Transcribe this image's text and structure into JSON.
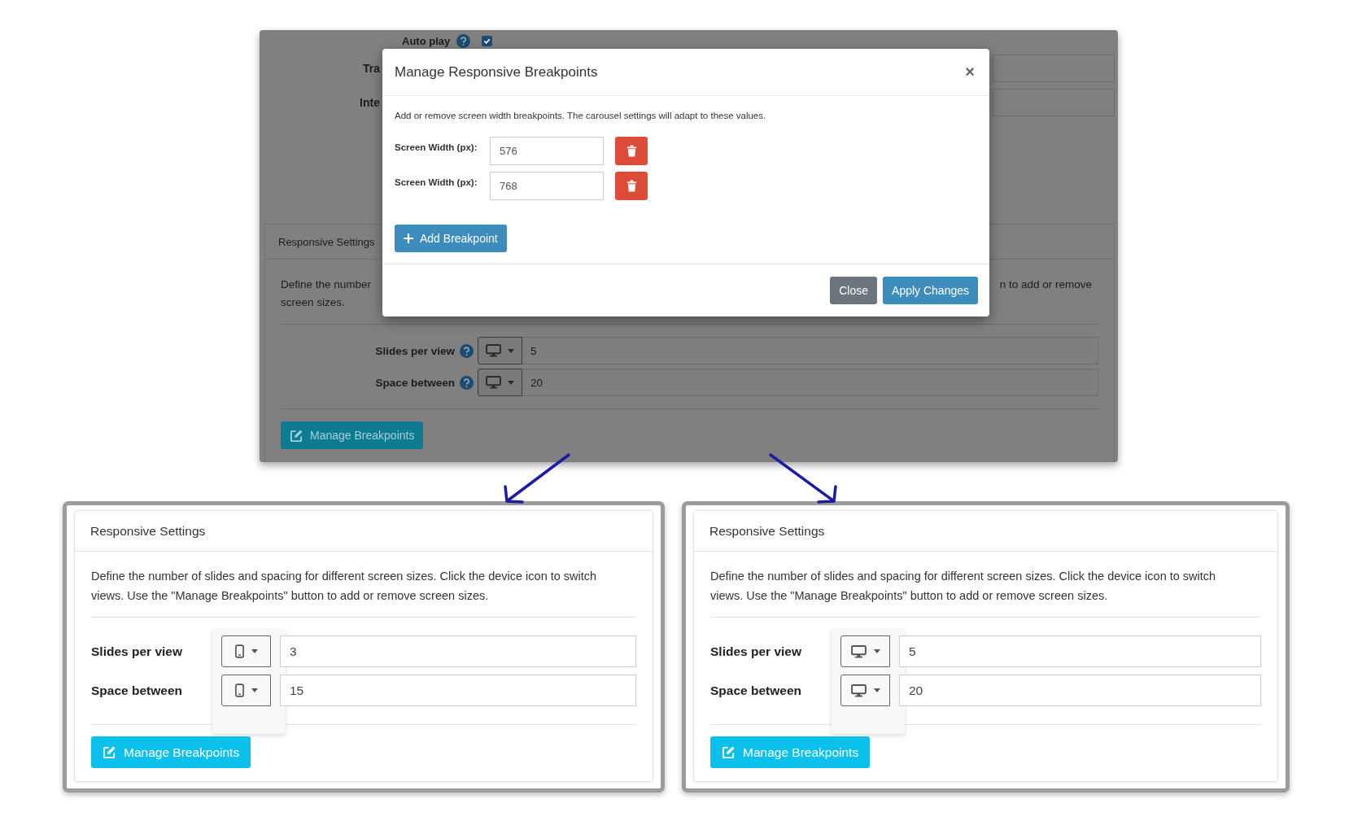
{
  "background_page": {
    "auto_play": {
      "label": "Auto play",
      "checked": true
    },
    "field_labels": [
      "Tra",
      "Inte"
    ],
    "responsive_settings": {
      "title": "Responsive Settings",
      "description_start": "Define the number",
      "description_end": "n to add or remove",
      "description_last": "screen sizes.",
      "rows": [
        {
          "label": "Slides per view",
          "kind": "desktop",
          "value": "5"
        },
        {
          "label": "Space between",
          "kind": "desktop",
          "value": "20"
        }
      ],
      "button": "Manage Breakpoints"
    }
  },
  "modal": {
    "title": "Manage Responsive Breakpoints",
    "close_icon": "×",
    "description": "Add or remove screen width breakpoints. The carousel settings will adapt to these values.",
    "breakpoints": [
      {
        "label": "Screen Width (px):",
        "value": "576"
      },
      {
        "label": "Screen Width (px):",
        "value": "768"
      }
    ],
    "add_button": "Add Breakpoint",
    "close_button": "Close",
    "apply_button": "Apply Changes"
  },
  "panels": [
    {
      "title": "Responsive Settings",
      "description": "Define the number of slides and spacing for different screen sizes. Click the device icon to switch views. Use the \"Manage Breakpoints\" button to add or remove screen sizes.",
      "rows": [
        {
          "label": "Slides per view",
          "kind": "mobile",
          "value": "3"
        },
        {
          "label": "Space between",
          "kind": "mobile",
          "value": "15"
        }
      ],
      "button": "Manage Breakpoints"
    },
    {
      "title": "Responsive Settings",
      "description": "Define the number of slides and spacing for different screen sizes. Click the device icon to switch views. Use the \"Manage Breakpoints\" button to add or remove screen sizes.",
      "rows": [
        {
          "label": "Slides per view",
          "kind": "desktop",
          "value": "5"
        },
        {
          "label": "Space between",
          "kind": "desktop",
          "value": "20"
        }
      ],
      "button": "Manage Breakpoints"
    }
  ]
}
